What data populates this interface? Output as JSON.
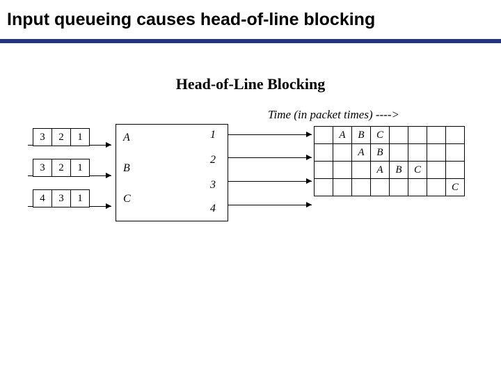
{
  "title": "Input queueing causes head-of-line blocking",
  "subtitle": "Head-of-Line Blocking",
  "time_header": "Time (in packet times) ---->",
  "queues": [
    [
      "3",
      "2",
      "1"
    ],
    [
      "3",
      "2",
      "1"
    ],
    [
      "4",
      "3",
      "1"
    ]
  ],
  "inputs": {
    "a": "A",
    "b": "B",
    "c": "C"
  },
  "outputs": {
    "o1": "1",
    "o2": "2",
    "o3": "3",
    "o4": "4"
  },
  "grid_columns": 8,
  "grid": [
    [
      "",
      "A",
      "B",
      "C",
      "",
      "",
      "",
      ""
    ],
    [
      "",
      "",
      "A",
      "B",
      "",
      "",
      "",
      ""
    ],
    [
      "",
      "",
      "",
      "A",
      "B",
      "C",
      "",
      ""
    ],
    [
      "",
      "",
      "",
      "",
      "",
      "",
      "",
      "C"
    ]
  ]
}
